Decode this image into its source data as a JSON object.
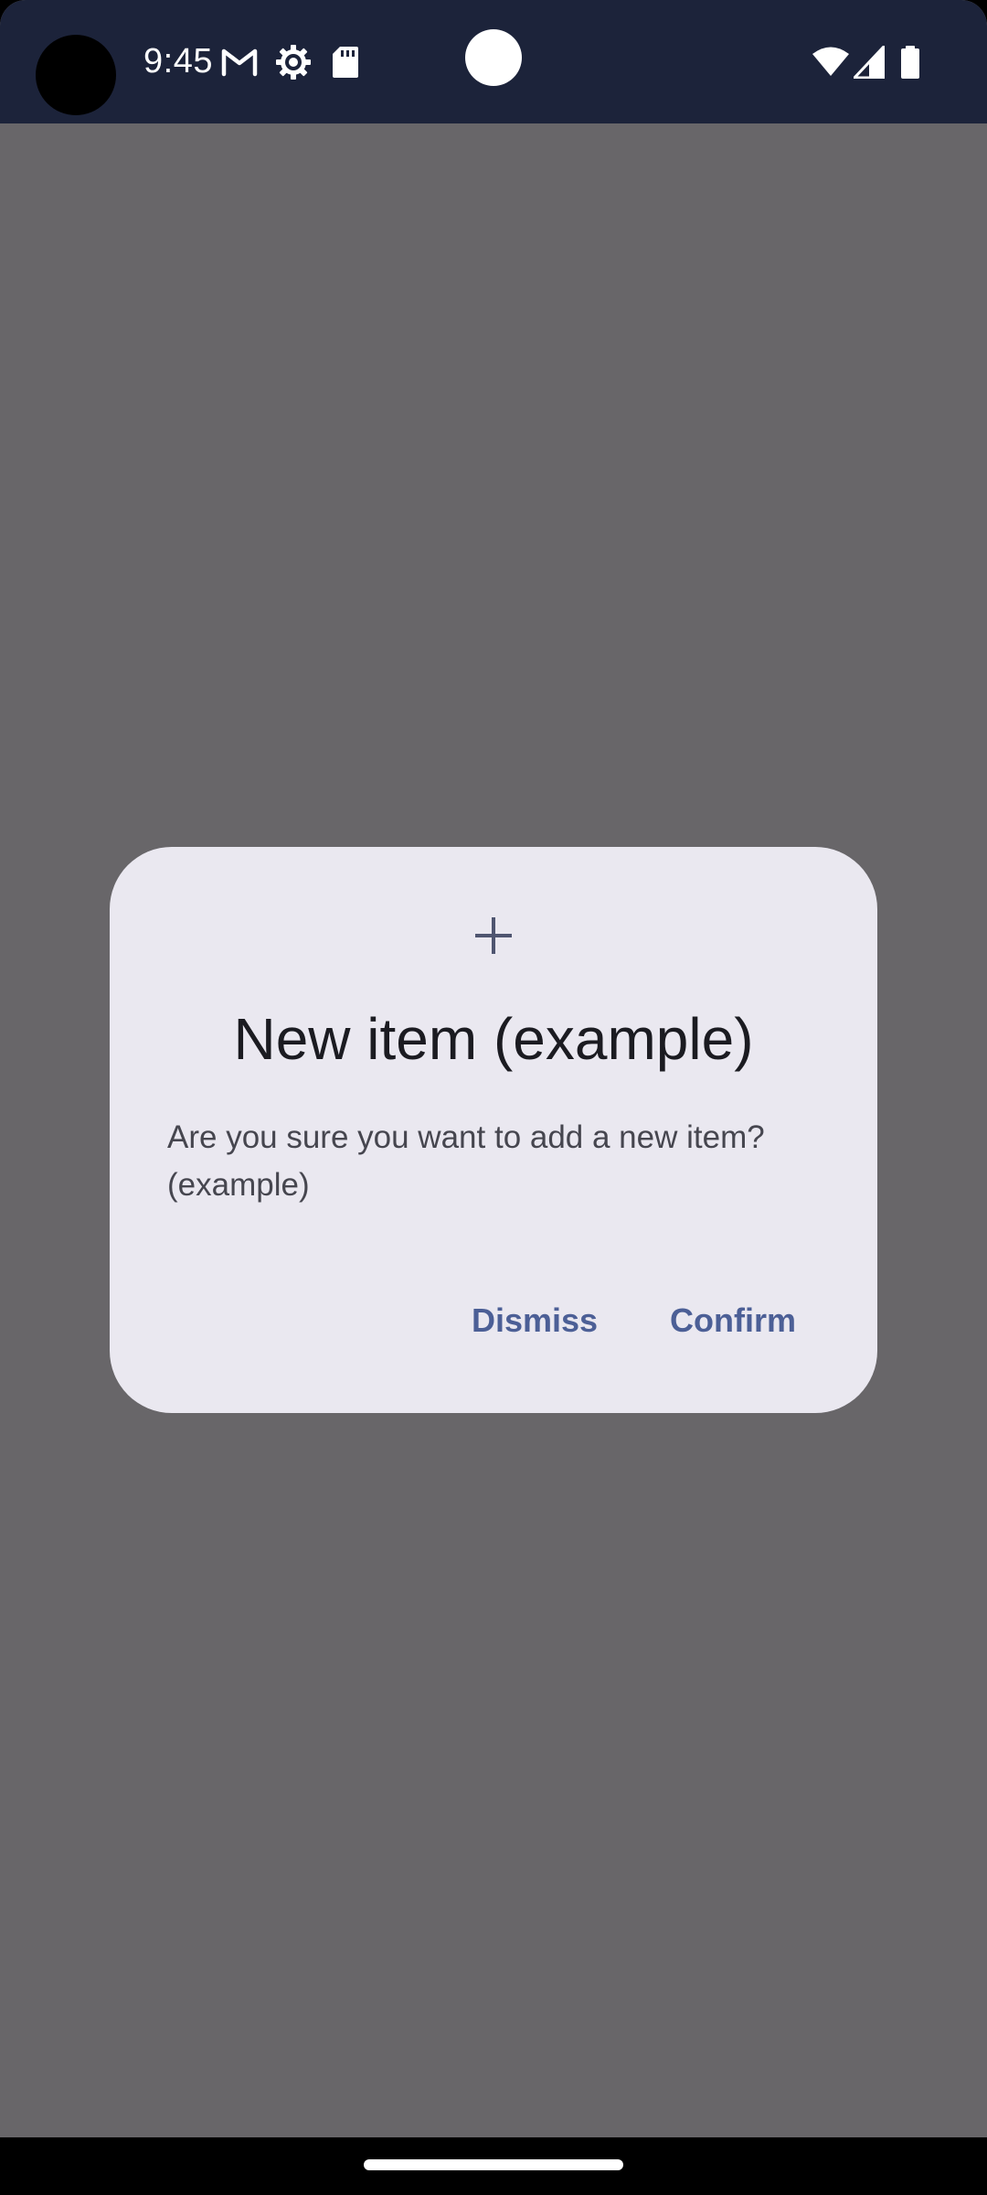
{
  "status_bar": {
    "time": "9:45",
    "icons": [
      "gmail-icon",
      "settings-icon",
      "sd-card-icon",
      "wifi-icon",
      "cell-signal-icon",
      "battery-icon"
    ]
  },
  "dialog": {
    "icon": "plus-icon",
    "title": "New item (example)",
    "body": "Are you sure you want to add a new item? (example)",
    "dismiss_label": "Dismiss",
    "confirm_label": "Confirm"
  },
  "colors": {
    "status_bar_bg": "#1c233a",
    "scrim": "#686669",
    "dialog_bg": "#eae8f0",
    "accent": "#4c5f96",
    "title_text": "#1b1b21",
    "body_text": "#46464f"
  }
}
